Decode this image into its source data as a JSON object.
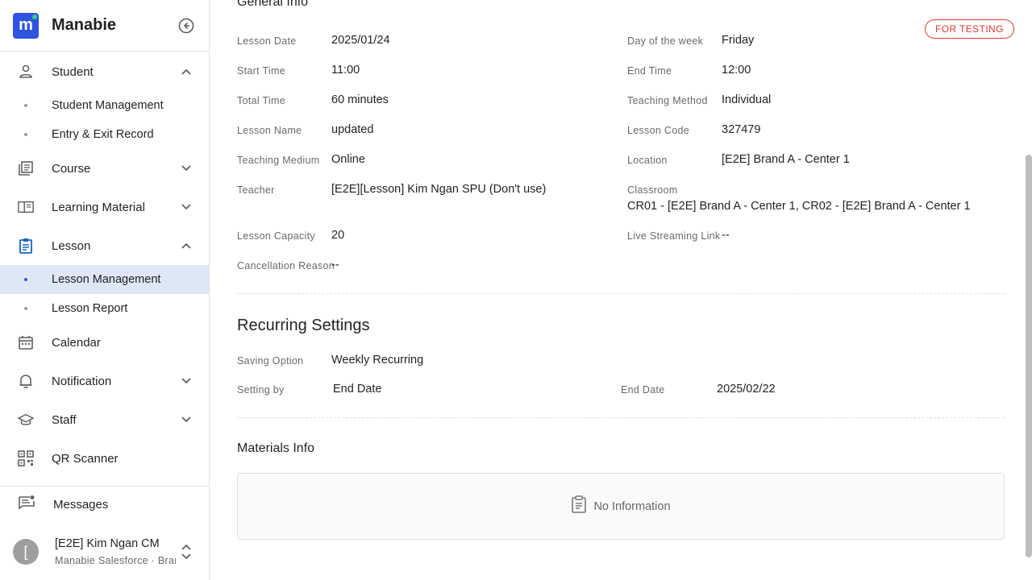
{
  "brand": {
    "name": "Manabie",
    "logo_letter": "m",
    "accent": "#3054e0"
  },
  "sidebar": {
    "student": {
      "label": "Student",
      "sub": [
        "Student Management",
        "Entry & Exit Record"
      ]
    },
    "course": {
      "label": "Course"
    },
    "learning_material": {
      "label": "Learning Material"
    },
    "lesson": {
      "label": "Lesson",
      "sub": [
        "Lesson Management",
        "Lesson Report"
      ]
    },
    "calendar": {
      "label": "Calendar"
    },
    "notification": {
      "label": "Notification"
    },
    "staff": {
      "label": "Staff"
    },
    "qr_scanner": {
      "label": "QR Scanner"
    },
    "messages": {
      "label": "Messages"
    },
    "user": {
      "avatar_letter": "[",
      "name": "[E2E] Kim Ngan CM",
      "org": "Manabie Salesforce · Brar"
    }
  },
  "general_info": {
    "title": "General Info",
    "badge": "FOR TESTING",
    "lesson_date": {
      "label": "Lesson Date",
      "value": "2025/01/24"
    },
    "day_of_week": {
      "label": "Day of the week",
      "value": "Friday"
    },
    "start_time": {
      "label": "Start Time",
      "value": "11:00"
    },
    "end_time": {
      "label": "End Time",
      "value": "12:00"
    },
    "total_time": {
      "label": "Total Time",
      "value": "60 minutes"
    },
    "teaching_method": {
      "label": "Teaching Method",
      "value": "Individual"
    },
    "lesson_name": {
      "label": "Lesson Name",
      "value": "updated"
    },
    "lesson_code": {
      "label": "Lesson Code",
      "value": "327479"
    },
    "teaching_medium": {
      "label": "Teaching Medium",
      "value": "Online"
    },
    "location": {
      "label": "Location",
      "value": "[E2E] Brand A - Center 1"
    },
    "teacher": {
      "label": "Teacher",
      "value": "[E2E][Lesson] Kim Ngan SPU (Don't use)"
    },
    "classroom": {
      "label": "Classroom",
      "value": "CR01 - [E2E] Brand A - Center 1, CR02 - [E2E] Brand A - Center 1"
    },
    "lesson_capacity": {
      "label": "Lesson Capacity",
      "value": "20"
    },
    "live_streaming": {
      "label": "Live Streaming Link",
      "value": "--"
    },
    "cancellation_reason": {
      "label": "Cancellation Reason",
      "value": "--"
    }
  },
  "recurring": {
    "title": "Recurring Settings",
    "saving_option": {
      "label": "Saving Option",
      "value": "Weekly Recurring"
    },
    "setting_by": {
      "label": "Setting by",
      "value": "End Date"
    },
    "end_date": {
      "label": "End Date",
      "value": "2025/02/22"
    }
  },
  "materials": {
    "title": "Materials Info",
    "empty_text": "No Information"
  },
  "colors": {
    "badge": "#e53935",
    "active_bg": "#dde7f6"
  }
}
